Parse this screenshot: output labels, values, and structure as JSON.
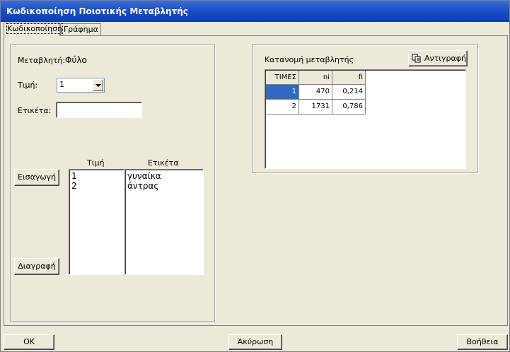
{
  "window": {
    "title": "Κωδικοποίηση Ποιοτικής Μεταβλητής"
  },
  "tabs": [
    {
      "label": "Κωδικοποίηση",
      "active": true
    },
    {
      "label": "Γράφημα",
      "active": false
    }
  ],
  "left": {
    "variable_label": "Μεταβλητή:",
    "variable_value": "Φύλο",
    "value_label": "Τιμή:",
    "value_selected": "1",
    "tag_label": "Ετικέτα:",
    "tag_value": "",
    "col_value": "Τιμή",
    "col_tag": "Ετικέτα",
    "insert_button": "Εισαγωγή",
    "delete_button": "Διαγραφή",
    "values": [
      "1",
      "2"
    ],
    "tags": [
      "γυναίκα",
      "άντρας"
    ]
  },
  "right": {
    "title": "Κατανομή μεταβλητής",
    "copy_button": "Αντιγραφή",
    "grid": {
      "headers": [
        "ΤΙΜΕΣ",
        "ni",
        "fi"
      ],
      "rows": [
        {
          "timi": "1",
          "ni": "470",
          "fi": "0,214"
        },
        {
          "timi": "2",
          "ni": "1731",
          "fi": "0,786"
        }
      ]
    }
  },
  "footer": {
    "ok": "OK",
    "cancel": "Ακύρωση",
    "help": "Βοήθεια"
  },
  "colors": {
    "titlebar": "#0a3cb8",
    "selection": "#316ac5",
    "face": "#ece9d8"
  }
}
